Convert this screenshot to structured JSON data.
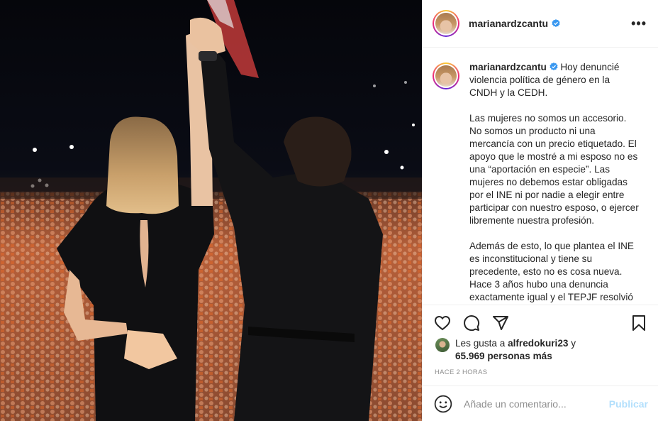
{
  "post": {
    "username": "marianardzcantu",
    "verified_color": "#3897f0",
    "more_label": "•••"
  },
  "caption": {
    "username": "marianardzcantu",
    "paragraphs": [
      "Hoy denuncié violencia política de género en la CNDH y la CEDH.",
      "Las mujeres no somos un accesorio. No somos un producto ni una mercancía con un precio etiquetado. El apoyo que le mostré a mi esposo no es una “aportación en especie”. Las mujeres no debemos estar obligadas por el INE ni por nadie a elegir entre participar con nuestro esposo, o ejercer libremente nuestra profesión.",
      "Además de esto, lo que plantea el INE es inconstitucional y tiene su precedente, esto no es cosa nueva. Hace 3 años hubo una denuncia exactamente igual y el TEPJF resolvió"
    ]
  },
  "actions": {
    "like_icon": "heart-icon",
    "comment_icon": "comment-icon",
    "share_icon": "share-icon",
    "save_icon": "bookmark-icon"
  },
  "likes": {
    "prefix": "Les gusta a ",
    "user": "alfredokuri23",
    "connector": " y",
    "count": "65.969 personas más"
  },
  "time_ago": "HACE 2 HORAS",
  "comment": {
    "placeholder": "Añade un comentario...",
    "publish_label": "Publicar",
    "publish_color": "#b2dffc"
  }
}
